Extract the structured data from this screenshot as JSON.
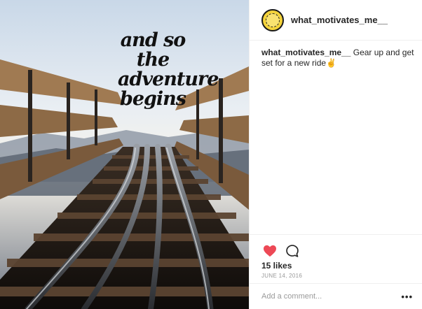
{
  "post": {
    "image": {
      "overlay_text": [
        "and so",
        "the",
        "adventure",
        "begins"
      ]
    },
    "header": {
      "username": "what_motivates_me__"
    },
    "caption": {
      "username": "what_motivates_me__",
      "text": " Gear up and get set for a new ride✌"
    },
    "actions": {
      "like_icon": "heart-filled-icon",
      "comment_icon": "comment-bubble-icon",
      "like_color": "#ed4956"
    },
    "likes": "15 likes",
    "date": "June 14, 2016",
    "comment": {
      "placeholder": "Add a comment...",
      "more_label": "•••"
    }
  }
}
